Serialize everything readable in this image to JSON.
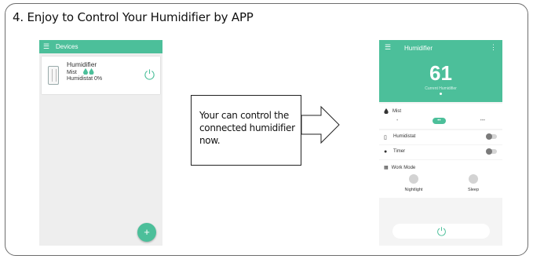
{
  "step_title": "4. Enjoy to Control Your Humidifier by APP",
  "left_phone": {
    "appbar": {
      "menu_icon": "☰",
      "title": "Devices"
    },
    "device": {
      "name": "Humidifier",
      "mist_label": "Mist",
      "mist_drops": "💧💧",
      "humidistat": "Humidistat 0%"
    },
    "fab_label": "+"
  },
  "callout": {
    "text": "Your can control the connected humidifier now."
  },
  "right_phone": {
    "header": {
      "menu_icon": "☰",
      "title": "Humidifier",
      "more_icon": "⋮",
      "value": "61",
      "caption": "Current Humidifier"
    },
    "mist": {
      "label": "Mist",
      "options": [
        "•",
        "••",
        "•••"
      ],
      "selected_index": 1
    },
    "humidistat_label": "Humidistat",
    "timer_label": "Timer",
    "work_mode": {
      "label": "Work Mode",
      "modes": [
        "Nightlight",
        "Sleep"
      ]
    }
  },
  "colors": {
    "accent": "#4cbf9a",
    "frame": "#6d6d6d"
  }
}
